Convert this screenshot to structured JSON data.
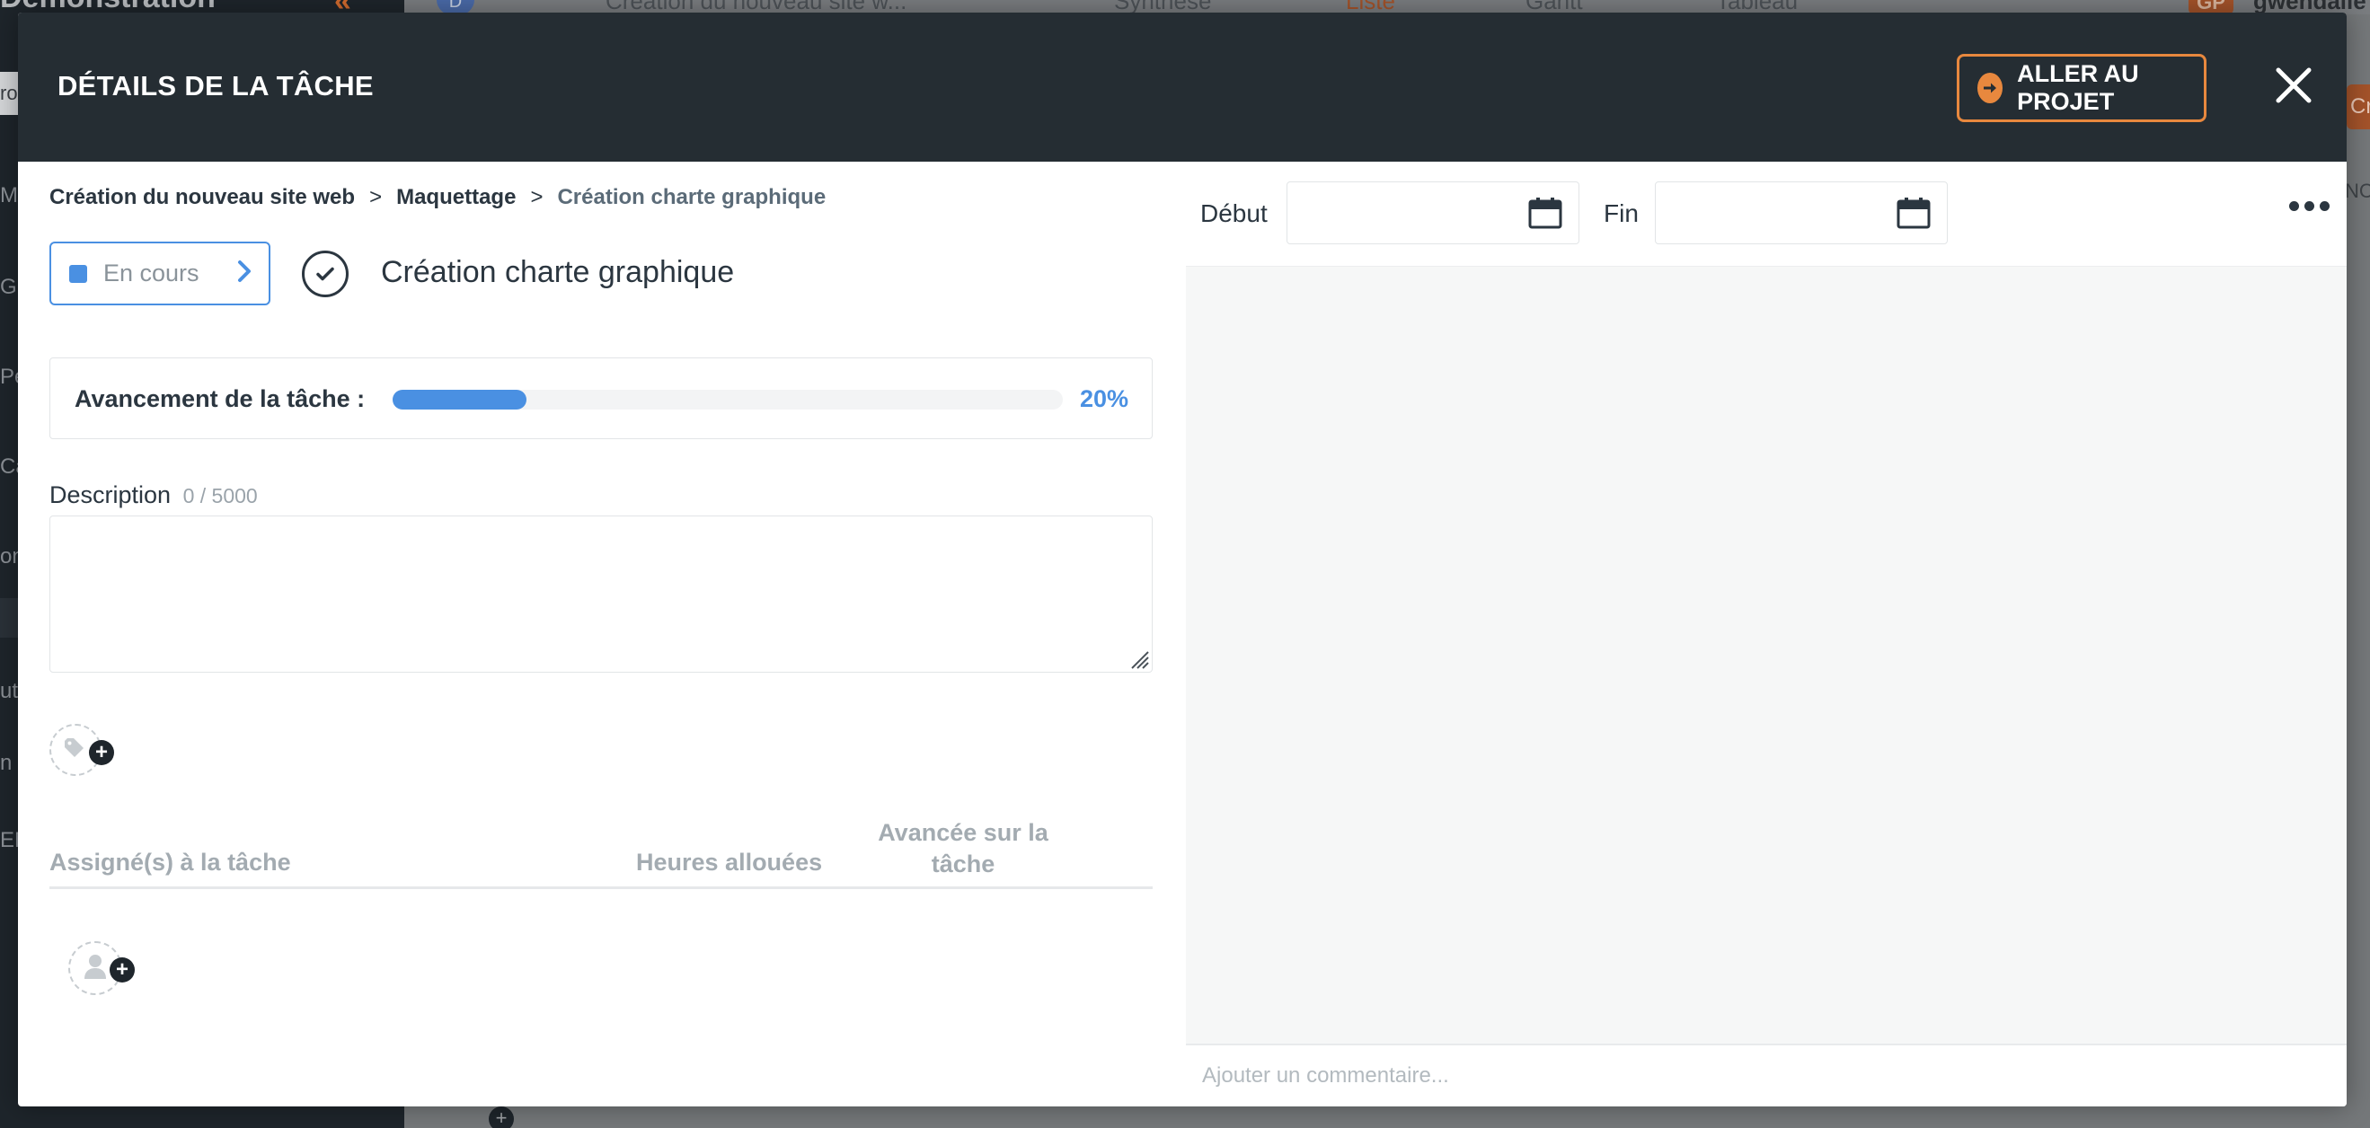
{
  "background": {
    "sidebar_brand": "Démonstration",
    "sidebar_fragments": [
      "ro",
      "M",
      "G",
      "Pe",
      "Ca",
      "on",
      "ut",
      "n",
      "EM"
    ],
    "project_select": "Création du nouveau site w...",
    "views": [
      "Synthèse",
      "Liste",
      "Gantt",
      "Tableau"
    ],
    "avatar_initial": "D",
    "user_initials": "GP",
    "user_name": "gwendalle",
    "right_button_fragment": "Cré",
    "right_text_fragment": "NC"
  },
  "modal": {
    "title": "DÉTAILS DE LA TÂCHE",
    "goto_project_label": "ALLER AU PROJET",
    "colors": {
      "header_bg": "#252d33",
      "accent_orange": "#e8883e",
      "accent_blue": "#4a90e2"
    }
  },
  "breadcrumb": {
    "items": [
      "Création du nouveau site web",
      "Maquettage",
      "Création charte graphique"
    ],
    "separator": ">"
  },
  "task": {
    "status_label": "En cours",
    "title": "Création charte graphique"
  },
  "progress": {
    "label": "Avancement de la tâche :",
    "value": 0.2,
    "percent_text": "20%"
  },
  "description": {
    "label": "Description",
    "count": "0 / 5000",
    "value": ""
  },
  "assignees": {
    "col_assigned": "Assigné(s) à la tâche",
    "col_hours": "Heures allouées",
    "col_progress": "Avancée sur la tâche"
  },
  "dates": {
    "start_label": "Début",
    "start_value": "",
    "end_label": "Fin",
    "end_value": ""
  },
  "comments": {
    "placeholder": "Ajouter un commentaire..."
  }
}
